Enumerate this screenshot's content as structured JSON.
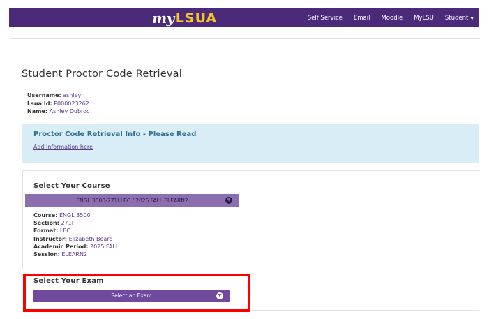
{
  "navbar": {
    "logo_my": "my",
    "logo_lsua": "LSUA",
    "links": [
      "Self Service",
      "Email",
      "Moodle",
      "MyLSU",
      "Student"
    ],
    "colors": {
      "bar": "#4b2a79",
      "logo_accent": "#f5c528"
    }
  },
  "page": {
    "title": "Student Proctor Code Retrieval"
  },
  "user": {
    "username_label": "Username:",
    "username": "ashleyr",
    "id_label": "Lsua Id:",
    "id": "P000023262",
    "name_label": "Name:",
    "name": "Ashley Dubroc"
  },
  "info": {
    "title": "Proctor Code Retrieval Info - Please Read",
    "link": "Add Information here"
  },
  "course": {
    "heading": "Select Your Course",
    "selected": "ENGL 3500-271I:LEC / 2025 FALL ELEARN2",
    "details": [
      {
        "label": "Course:",
        "value": "ENGL 3500"
      },
      {
        "label": "Section:",
        "value": "271I"
      },
      {
        "label": "Format:",
        "value": "LEC"
      },
      {
        "label": "Instructor:",
        "value": "Elizabeth Beard"
      },
      {
        "label": "Academic Period:",
        "value": "2025 FALL"
      },
      {
        "label": "Session:",
        "value": "ELEARN2"
      }
    ]
  },
  "exam": {
    "heading": "Select Your Exam",
    "selected": "Select an Exam"
  },
  "icons": {
    "dropdown": "chevron-down-icon",
    "student_menu": "caret-down-icon"
  }
}
